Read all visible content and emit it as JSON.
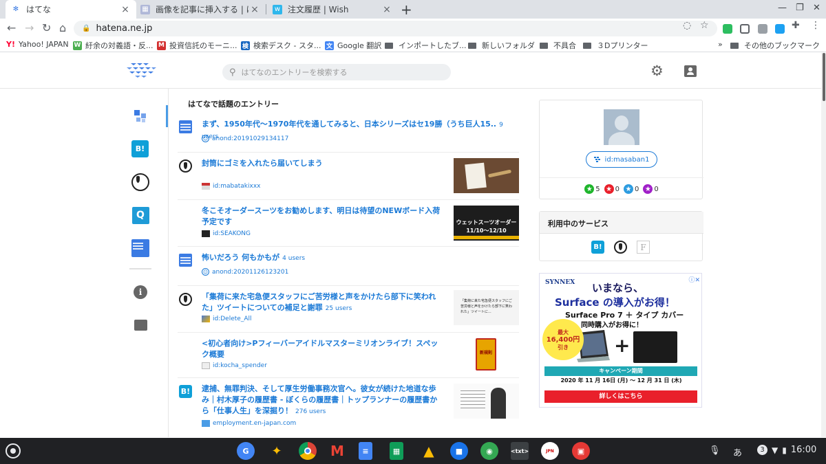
{
  "tabs": [
    {
      "title": "はてな",
      "active": true
    },
    {
      "title": "画像を記事に挿入する | はてなブ",
      "active": false
    },
    {
      "title": "注文履歴 | Wish",
      "active": false
    }
  ],
  "address": {
    "url": "hatena.ne.jp"
  },
  "bookmarks": [
    {
      "label": "Yahoo! JAPAN",
      "icon": "yahoo-icon"
    },
    {
      "label": "紆余の対義語・反...",
      "icon": "weblio-icon"
    },
    {
      "label": "投資信託のモーニ...",
      "icon": "morningstar-icon"
    },
    {
      "label": "検索デスク - スタ...",
      "icon": "search-desk-icon"
    },
    {
      "label": "Google 翻訳",
      "icon": "translate-icon"
    },
    {
      "label": "インポートしたブ...",
      "icon": "folder-icon"
    },
    {
      "label": "新しいフォルダ",
      "icon": "folder-icon"
    },
    {
      "label": "不具合",
      "icon": "folder-icon"
    },
    {
      "label": "３Dプリンター",
      "icon": "folder-icon"
    },
    {
      "label": "»",
      "icon": ""
    },
    {
      "label": "その他のブックマーク",
      "icon": "folder-icon"
    }
  ],
  "header": {
    "search_placeholder": "はてなのエントリーを検索する"
  },
  "feed": {
    "title": "はてなで話題のエントリー",
    "entries": [
      {
        "title": "まず、1950年代〜1970年代を通してみると、日本シリーズはセ19勝（うち巨人15..",
        "users": "9 users",
        "author": "anond:20191029134117",
        "source": "anond"
      },
      {
        "title": "封筒にゴミを入れたら届いてしまう",
        "users": "",
        "author": "id:mabatakixxx",
        "source": "blog"
      },
      {
        "title": "冬こそオーダースーツをお勧めします、明日は待望のNEWボード入荷予定です",
        "users": "",
        "author": "id:SEAKONG",
        "source": "blog"
      },
      {
        "title": "怖いだろう 何もかもが",
        "users": "4 users",
        "author": "anond:20201126123201",
        "source": "anond"
      },
      {
        "title": "「集荷に来た宅急便スタッフにご苦労様と声をかけたら部下に笑われた」ツイートについての補足と謝罪",
        "users": "25 users",
        "author": "id:Delete_All",
        "source": "blog"
      },
      {
        "title": "<初心者向け>Pフィーバーアイドルマスターミリオンライブ！スペック概要",
        "users": "",
        "author": "id:kocha_spender",
        "source": "blog"
      },
      {
        "title": "逮捕、無罪判決、そして厚生労働事務次官へ。彼女が続けた地道な歩み｜村木厚子の履歴書 - ぼくらの履歴書｜トップランナーの履歴書から「仕事人生」を深掘り！",
        "users": "276 users",
        "author": "employment.en-japan.com",
        "source": "bookmark"
      }
    ],
    "thumbs": {
      "suit_line1": "ウェットスーツオーダー",
      "suit_line2": "11/10〜12/10",
      "tweet_text": "「集荷に来た宅急便スタッフにご苦労様と声をかけたら部下に笑われた」ツイートに...",
      "pachinko": "新規則"
    }
  },
  "profile": {
    "id_label": "id:masaban1",
    "stars": [
      {
        "color": "#1fb52c",
        "count": "5"
      },
      {
        "color": "#e9202b",
        "count": "0"
      },
      {
        "color": "#2d9ce0",
        "count": "0"
      },
      {
        "color": "#a020c8",
        "count": "0"
      }
    ]
  },
  "services": {
    "title": "利用中のサービス",
    "f_label": "F"
  },
  "ad": {
    "brand": "SYNNEX",
    "line1": "いまなら、",
    "line2": "Surface の導入がお得！",
    "line3": "Surface Pro 7 ＋ タイプ カバー",
    "line4": "同時購入がお得に！",
    "burst_top": "最大",
    "burst_price": "16,400円",
    "burst_bottom": "引き",
    "band": "キャンペーン期間",
    "dates": "2020 年 11 月 16日 (月) 〜 12 月 31 日 (木)",
    "cta": "詳しくはこちら"
  },
  "shelf": {
    "apps": [
      {
        "name": "google-translate-app",
        "color": "#4285f4",
        "label": "G"
      },
      {
        "name": "photos-app",
        "color": "#202124",
        "label": "✦"
      },
      {
        "name": "chrome-app",
        "color": "#db4437",
        "label": "●"
      },
      {
        "name": "gmail-app",
        "color": "#202124",
        "label": "M"
      },
      {
        "name": "docs-app",
        "color": "#4285f4",
        "label": "≡"
      },
      {
        "name": "sheets-app",
        "color": "#0f9d58",
        "label": "▦"
      },
      {
        "name": "drive-app",
        "color": "#202124",
        "label": "▲"
      },
      {
        "name": "files-app",
        "color": "#1a73e8",
        "label": "■"
      },
      {
        "name": "maps-app",
        "color": "#34a853",
        "label": "◉"
      },
      {
        "name": "text-app",
        "color": "#3c4043",
        "label": "<txt>"
      },
      {
        "name": "ime-app",
        "color": "#ffffff",
        "label": "JPN"
      },
      {
        "name": "gallery-app",
        "color": "#e53935",
        "label": "▣"
      }
    ],
    "ime": "あ",
    "notification_count": "3",
    "time": "16:00"
  }
}
